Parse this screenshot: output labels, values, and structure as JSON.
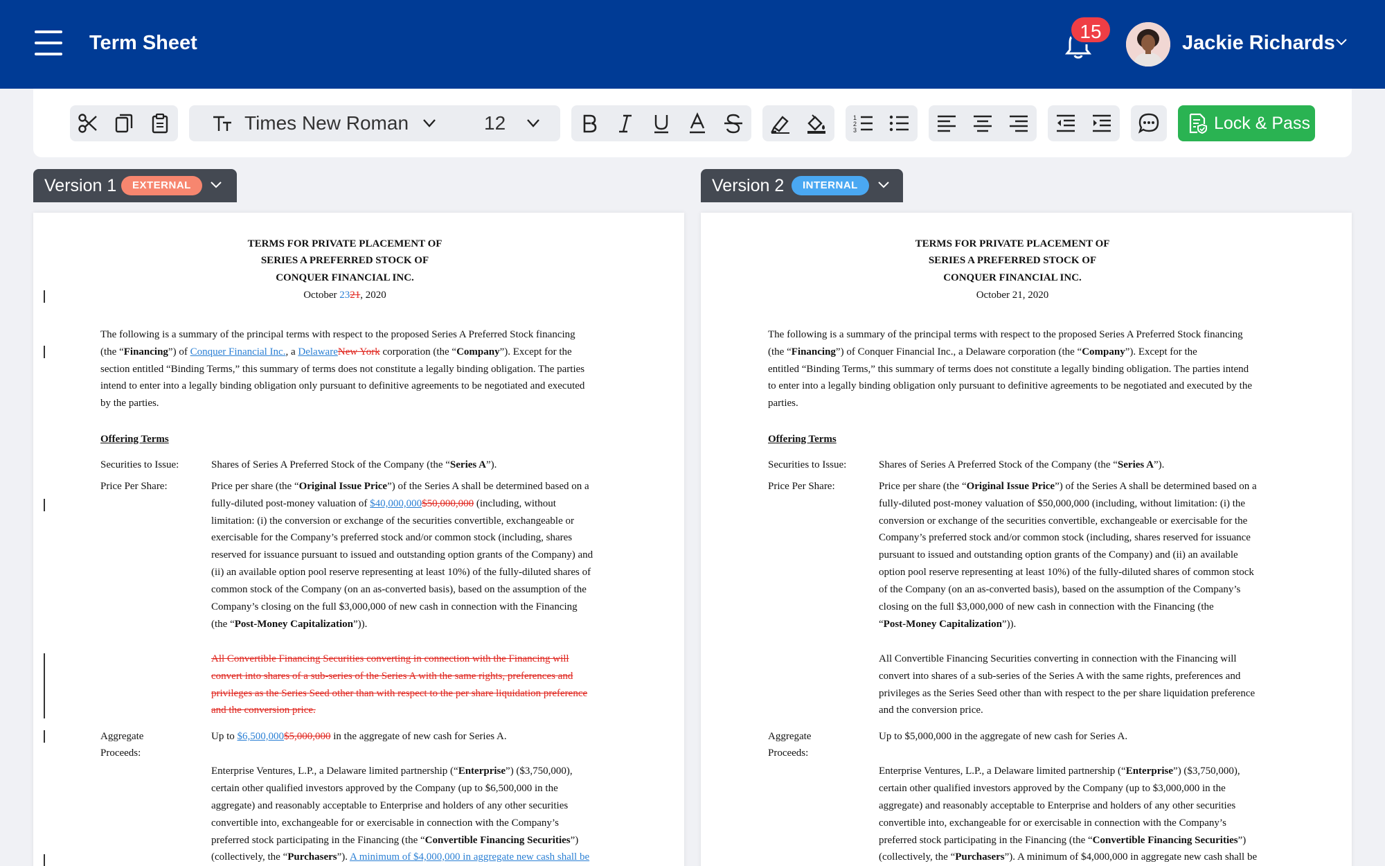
{
  "header": {
    "title": "Term Sheet",
    "notification_count": "15",
    "user_name": "Jackie Richards",
    "colors": {
      "bar": "#003b95",
      "badge": "#ef3e45",
      "accent_green": "#2ab352"
    }
  },
  "toolbar": {
    "font_name": "Times New Roman",
    "font_size": "12",
    "lock_label": "Lock & Pass",
    "icons": [
      "scissors-icon",
      "copy-icon",
      "paste-icon",
      "text-size-icon",
      "bold-icon",
      "italic-icon",
      "underline-icon",
      "font-color-icon",
      "strikethrough-icon",
      "highlighter-icon",
      "fill-bucket-icon",
      "numbered-list-icon",
      "bullet-list-icon",
      "align-left-icon",
      "align-center-icon",
      "align-right-icon",
      "outdent-icon",
      "indent-icon",
      "comment-icon",
      "lock-doc-icon"
    ]
  },
  "versions": [
    {
      "label": "Version 1",
      "badge": "EXTERNAL",
      "badge_color": "#f7866f"
    },
    {
      "label": "Version 2",
      "badge": "INTERNAL",
      "badge_color": "#4aa8f2"
    }
  ],
  "doc": {
    "title1": "TERMS FOR PRIVATE PLACEMENT OF",
    "title2": "SERIES A PREFERRED STOCK OF",
    "title3": "CONQUER FINANCIAL INC.",
    "date_prefix": "October ",
    "date_suffix": ", 2020",
    "v1_date_ins": "23",
    "v1_date_del": "21",
    "v2_date": "October 21, 2020",
    "intro1": "The following is a summary of the principal terms with respect to the proposed Series A Preferred Stock financing",
    "intro2_a": "(the “",
    "intro2_b": "Financing",
    "intro2_c": "”) of ",
    "v1_intro2_ins1": "Conquer Financial Inc.",
    "intro2_d": ", a ",
    "v1_intro2_ins2": "Delaware",
    "v1_intro2_del2": "New York",
    "intro2_e": " corporation (the “",
    "intro2_f": "Company",
    "intro2_g": "”).  Except for the",
    "v2_intro2_plain": "”) of Conquer Financial Inc., a Delaware corporation (the “",
    "v1_intro3": "section entitled “Binding Terms,” this summary of terms does not constitute a legally binding obligation.  The parties",
    "v1_intro4": "intend to enter into a legally binding obligation only pursuant to definitive agreements to be negotiated and executed",
    "v1_intro5": "by the parties.",
    "v2_intro3": "entitled “Binding Terms,” this summary of terms does not constitute a legally binding obligation.  The parties intend",
    "v2_intro4": "to enter into a legally binding obligation only pursuant to definitive agreements to be negotiated and executed by the",
    "v2_intro5": "parties.",
    "offering_terms": "Offering Terms",
    "sec_label": "Securities to Issue:",
    "sec_a": "Shares of Series A Preferred Stock of the Company (the “",
    "sec_b": "Series A",
    "sec_c": "”).",
    "pps_label": "Price Per Share:",
    "pps1_a": "Price per share (the “",
    "pps1_b": "Original Issue Price",
    "pps1_c": "”) of the Series A shall be determined based on a",
    "v1_pps2_a": "fully-diluted post-money valuation of ",
    "v1_pps2_ins": "$40,000,000",
    "v1_pps2_del": "$50,000,000",
    "v1_pps2_b": " (including, without",
    "v1_pps": [
      "limitation: (i) the conversion or exchange of the securities convertible, exchangeable or",
      "exercisable for the Company’s preferred stock and/or common stock (including, shares",
      "reserved for issuance pursuant to issued and outstanding option grants of the Company) and",
      "(ii) an available option pool reserve representing at least 10%) of the fully-diluted shares of",
      "common stock of the Company (on an as-converted basis), based on the assumption of the",
      "Company’s closing on the full $3,000,000 of new cash in connection with the Financing"
    ],
    "v1_pps_last_a": "(the “",
    "pmc": "Post-Money Capitalization",
    "pmc_end": "”)).",
    "v2_pps2": "fully-diluted post-money valuation of $50,000,000 (including, without limitation: (i) the",
    "v2_pps": [
      "conversion or exchange of the securities convertible, exchangeable or exercisable for the",
      "Company’s preferred stock and/or common stock (including, shares reserved for issuance",
      "pursuant to issued and outstanding option grants of the Company) and (ii) an available",
      "option pool reserve representing at least 10%) of the fully-diluted shares of common stock",
      "of the Company (on an as-converted basis), based on the assumption of the Company’s",
      "closing on the full $3,000,000 of new cash in connection with the Financing (the"
    ],
    "v2_pps_last_a": "“",
    "v1_conv": [
      "All Convertible Financing Securities converting in connection with the Financing will",
      "convert into shares of a sub-series of the Series A with the same rights, preferences and",
      "privileges as the Series Seed other than with respect to the per share liquidation preference",
      "and the conversion price."
    ],
    "v2_conv": [
      "All Convertible Financing Securities converting in connection with the Financing will",
      "convert into shares of a sub-series of the Series A with the same rights, preferences and",
      "privileges as the Series Seed other than with respect to the per share liquidation preference",
      "and the conversion price."
    ],
    "agg_label1": "Aggregate",
    "agg_label2": "Proceeds:",
    "agg_a": "Up to ",
    "v1_agg_ins": "$6,500,000",
    "v1_agg_del": "$5,000,000",
    "agg_b": " in the aggregate of new cash for Series A.",
    "v2_agg": "Up to $5,000,000 in the aggregate of new cash for Series A.",
    "ent1_a": "Enterprise Ventures, L.P., a Delaware limited partnership (“",
    "ent1_b": "Enterprise",
    "ent1_c": "”) ($3,750,000),",
    "v1_ent2": "certain other qualified investors approved by the Company (up to $6,500,000 in the",
    "v2_ent2": "certain other qualified investors approved by the Company (up to $3,000,000 in the",
    "ent3": "aggregate) and reasonably acceptable to Enterprise and holders of any other securities",
    "ent4": "convertible into, exchangeable for or exercisable in connection with the Company’s",
    "ent5_a": "preferred stock participating in the Financing (the “",
    "ent5_b": "Convertible Financing Securities",
    "ent5_c": "”)",
    "ent6_a": "(collectively, the “",
    "ent6_b": "Purchasers",
    "ent6_c": "”). ",
    "v1_ent6_ins": "A minimum of $4,000,000 in aggregate new cash shall be",
    "v2_ent6_d": "A minimum of $4,000,000 in aggregate new cash shall be"
  }
}
